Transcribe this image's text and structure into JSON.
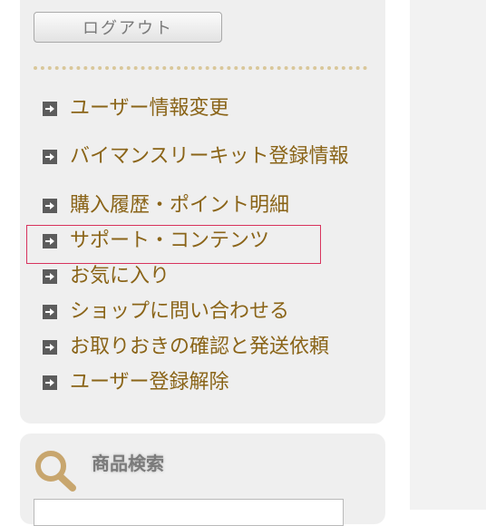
{
  "logout": {
    "label": "ログアウト"
  },
  "menu": {
    "items": [
      {
        "label": "ユーザー情報変更"
      },
      {
        "label": "バイマンスリーキット登録情報"
      },
      {
        "label": "購入履歴・ポイント明細"
      },
      {
        "label": "サポート・コンテンツ",
        "highlighted": true
      },
      {
        "label": "お気に入り"
      },
      {
        "label": "ショップに問い合わせる"
      },
      {
        "label": "お取りおきの確認と発送依頼"
      },
      {
        "label": "ユーザー登録解除"
      }
    ]
  },
  "search": {
    "title": "商品検索",
    "value": "",
    "icon": "magnifier-icon"
  },
  "colors": {
    "menu_text": "#8a6418",
    "highlight_border": "#d8335d",
    "panel_background": "#efefef",
    "divider": "#d9c79a"
  }
}
